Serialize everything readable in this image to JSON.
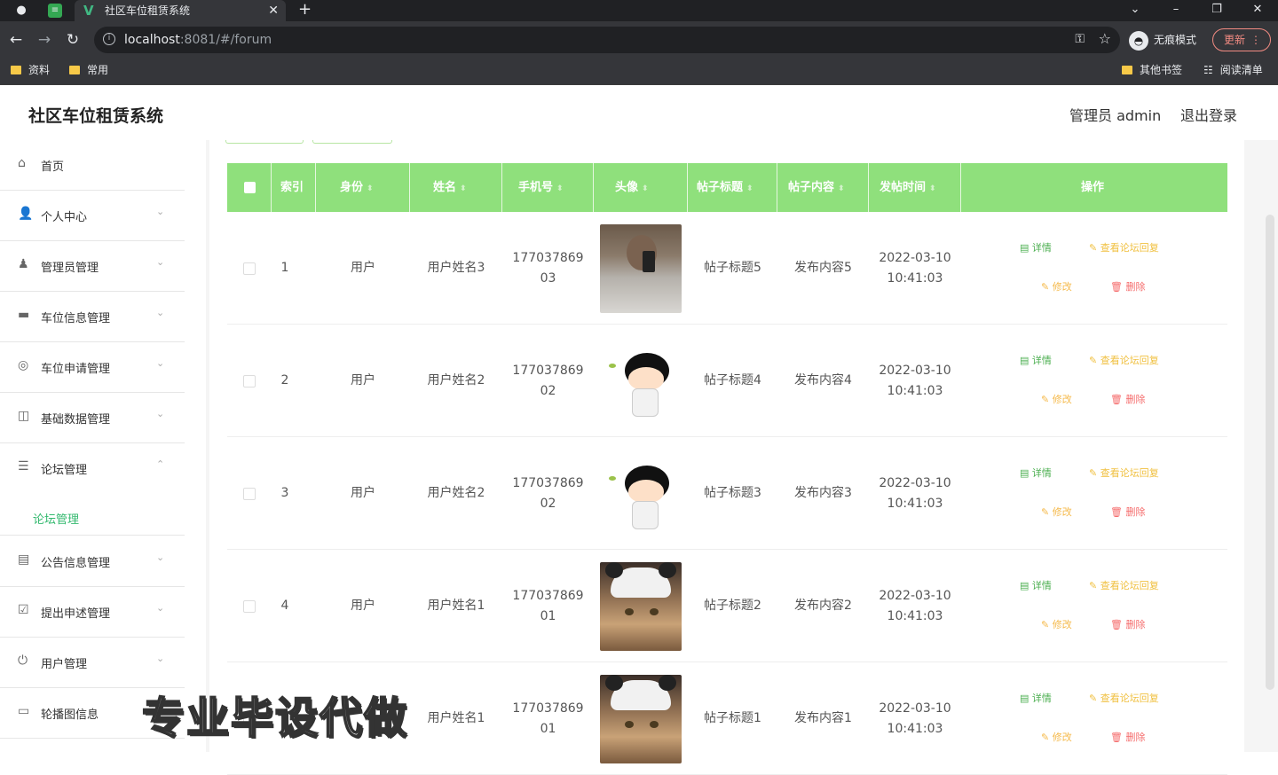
{
  "browser": {
    "tab_title": "社区车位租赁系统",
    "url_host": "localhost",
    "url_rest": ":8081/#/forum",
    "incognito_label": "无痕模式",
    "update_label": "更新",
    "bookmarks": [
      "资料",
      "常用"
    ],
    "bookmarks_right": [
      "其他书签",
      "阅读清单"
    ]
  },
  "header": {
    "title": "社区车位租赁系统",
    "user": "管理员 admin",
    "logout": "退出登录"
  },
  "sidebar": {
    "items": [
      {
        "label": "首页",
        "icon": "home-icon"
      },
      {
        "label": "个人中心",
        "icon": "user-icon"
      },
      {
        "label": "管理员管理",
        "icon": "admin-icon"
      },
      {
        "label": "车位信息管理",
        "icon": "parking-icon"
      },
      {
        "label": "车位申请管理",
        "icon": "compass-icon"
      },
      {
        "label": "基础数据管理",
        "icon": "data-icon"
      },
      {
        "label": "论坛管理",
        "icon": "forum-icon"
      },
      {
        "label": "公告信息管理",
        "icon": "notice-icon"
      },
      {
        "label": "提出申述管理",
        "icon": "complaint-icon"
      },
      {
        "label": "用户管理",
        "icon": "power-icon"
      },
      {
        "label": "轮播图信息",
        "icon": "carousel-icon"
      }
    ],
    "active_sub": "论坛管理"
  },
  "table": {
    "columns": [
      "索引",
      "身份",
      "姓名",
      "手机号",
      "头像",
      "帖子标题",
      "帖子内容",
      "发帖时间",
      "操作"
    ],
    "rows": [
      {
        "index": "1",
        "role": "用户",
        "name": "用户姓名3",
        "phone_a": "177037869",
        "phone_b": "03",
        "avatar": "photo-person",
        "title": "帖子标题5",
        "content": "发布内容5",
        "date": "2022-03-10",
        "time": "10:41:03"
      },
      {
        "index": "2",
        "role": "用户",
        "name": "用户姓名2",
        "phone_a": "177037869",
        "phone_b": "02",
        "avatar": "cartoon-boy",
        "title": "帖子标题4",
        "content": "发布内容4",
        "date": "2022-03-10",
        "time": "10:41:03"
      },
      {
        "index": "3",
        "role": "用户",
        "name": "用户姓名2",
        "phone_a": "177037869",
        "phone_b": "02",
        "avatar": "cartoon-boy",
        "title": "帖子标题3",
        "content": "发布内容3",
        "date": "2022-03-10",
        "time": "10:41:03"
      },
      {
        "index": "4",
        "role": "用户",
        "name": "用户姓名1",
        "phone_a": "177037869",
        "phone_b": "01",
        "avatar": "cat-photo",
        "title": "帖子标题2",
        "content": "发布内容2",
        "date": "2022-03-10",
        "time": "10:41:03"
      },
      {
        "index": "",
        "role": "",
        "name": "用户姓名1",
        "phone_a": "177037869",
        "phone_b": "01",
        "avatar": "cat-photo",
        "title": "帖子标题1",
        "content": "发布内容1",
        "date": "2022-03-10",
        "time": "10:41:03"
      }
    ],
    "actions": {
      "detail": "详情",
      "reply": "查看论坛回复",
      "edit": "修改",
      "delete": "删除"
    }
  },
  "watermark": "专业毕设代做"
}
